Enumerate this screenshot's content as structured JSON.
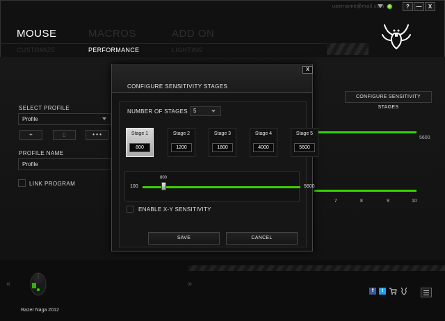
{
  "window": {
    "user_email": "username@mail.com",
    "buttons": {
      "help": "?",
      "minimize": "—",
      "close": "X"
    }
  },
  "nav": {
    "main_tabs": [
      {
        "label": "MOUSE",
        "active": true
      },
      {
        "label": "MACROS",
        "active": false
      },
      {
        "label": "ADD ON",
        "active": false
      }
    ],
    "sub_tabs": [
      {
        "label": "CUSTOMIZE",
        "active": false
      },
      {
        "label": "PERFORMANCE",
        "active": true
      },
      {
        "label": "LIGHTING",
        "active": false
      }
    ]
  },
  "profile": {
    "select_label": "SELECT PROFILE",
    "selected": "Profile",
    "add_label": "+",
    "delete_label": "▯",
    "more_label": "• • •",
    "name_label": "PROFILE NAME",
    "name_value": "Profile",
    "link_program_label": "LINK PROGRAM"
  },
  "background": {
    "configure_button": "CONFIGURE SENSITIVITY STAGES",
    "sensitivity_max": "5600",
    "scale_labels": [
      "7",
      "8",
      "9",
      "10"
    ]
  },
  "modal": {
    "title": "CONFIGURE SENSITIVITY STAGES",
    "close": "X",
    "number_of_stages_label": "NUMBER OF STAGES",
    "number_of_stages_value": "5",
    "stages": [
      {
        "label": "Stage 1",
        "value": "800",
        "active": true
      },
      {
        "label": "Stage 2",
        "value": "1200",
        "active": false
      },
      {
        "label": "Stage 3",
        "value": "1800",
        "active": false
      },
      {
        "label": "Stage 4",
        "value": "4000",
        "active": false
      },
      {
        "label": "Stage 5",
        "value": "5600",
        "active": false
      }
    ],
    "slider": {
      "min": "100",
      "max": "5600",
      "current": "800"
    },
    "xy_label": "ENABLE X-Y SENSITIVITY",
    "save": "SAVE",
    "cancel": "CANCEL"
  },
  "footer": {
    "device_name": "Razer Naga 2012",
    "left_chevron": "«",
    "right_chevron": "»",
    "social": [
      {
        "name": "facebook-icon",
        "glyph": "f",
        "color": "#3b5998"
      },
      {
        "name": "twitter-icon",
        "glyph": "t",
        "color": "#1da1f2"
      }
    ]
  },
  "colors": {
    "accent": "#3ad000",
    "background": "#111111"
  }
}
